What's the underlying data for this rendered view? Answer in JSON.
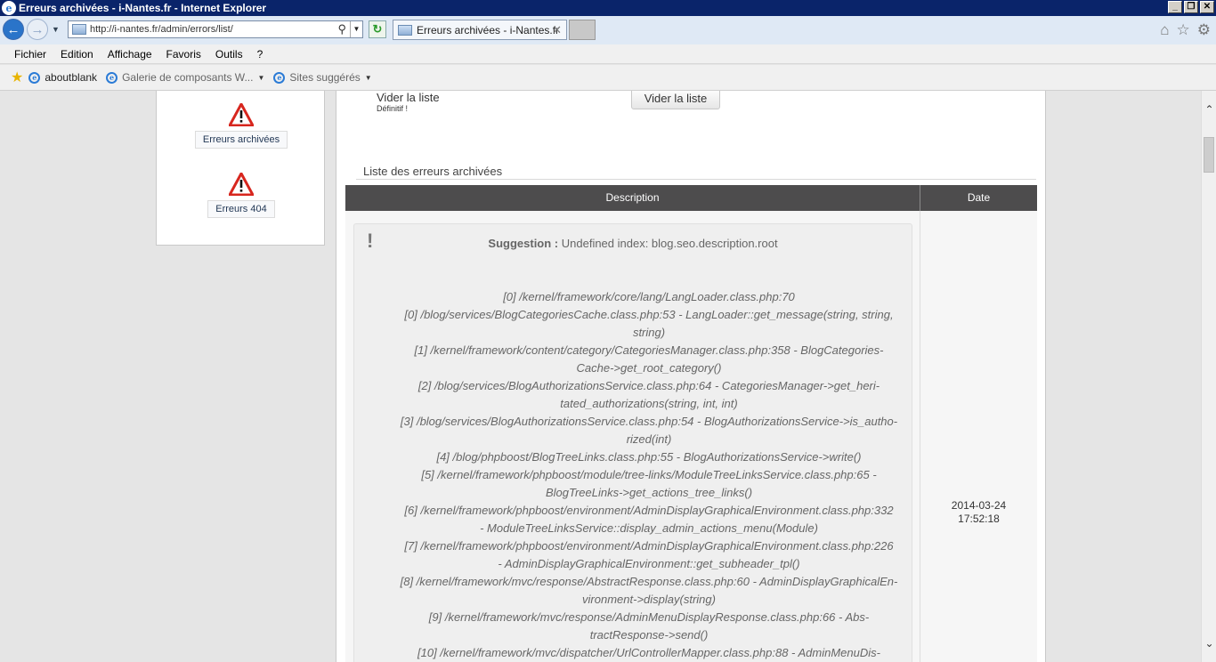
{
  "window": {
    "title": "Erreurs archivées - i-Nantes.fr - Internet Explorer",
    "minimize": "_",
    "restore": "❐",
    "close": "✕"
  },
  "nav": {
    "url": "http://i-nantes.fr/admin/errors/list/",
    "tab_label": "Erreurs archivées - i-Nantes.fr",
    "icons": [
      "back-icon",
      "forward-icon",
      "search-icon",
      "refresh-icon",
      "home-icon",
      "star-icon",
      "gear-icon"
    ]
  },
  "menu": {
    "items": [
      "Fichier",
      "Edition",
      "Affichage",
      "Favoris",
      "Outils",
      "?"
    ]
  },
  "favorites": {
    "items": [
      {
        "label": "aboutblank"
      },
      {
        "label": "Galerie de composants W..."
      },
      {
        "label": "Sites suggérés"
      }
    ]
  },
  "sidebar": {
    "tiles": [
      {
        "label": "Erreurs archivées"
      },
      {
        "label": "Erreurs 404"
      }
    ]
  },
  "main": {
    "clear_title": "Vider la liste",
    "clear_sub": "Définitif !",
    "clear_button": "Vider la liste",
    "section_title": "Liste des erreurs archivées",
    "table": {
      "headers": [
        "Description",
        "Date"
      ],
      "row": {
        "suggestion_label": "Suggestion :",
        "suggestion_text": "Undefined index: blog.seo.description.root",
        "trace": [
          "[0] /kernel/framework/core/lang/LangLoader.class.php:70",
          "[0] /blog/services/BlogCategoriesCache.class.php:53 - LangLoader::get_message(string, string,",
          "string)",
          "[1] /kernel/framework/content/category/CategoriesManager.class.php:358 - BlogCategories-",
          "Cache->get_root_category()",
          "[2] /blog/services/BlogAuthorizationsService.class.php:64 - CategoriesManager->get_heri-",
          "tated_authorizations(string, int, int)",
          "[3] /blog/services/BlogAuthorizationsService.class.php:54 - BlogAuthorizationsService->is_autho-",
          "rized(int)",
          "[4] /blog/phpboost/BlogTreeLinks.class.php:55 - BlogAuthorizationsService->write()",
          "[5] /kernel/framework/phpboost/module/tree-links/ModuleTreeLinksService.class.php:65 -",
          "BlogTreeLinks->get_actions_tree_links()",
          "[6] /kernel/framework/phpboost/environment/AdminDisplayGraphicalEnvironment.class.php:332",
          "- ModuleTreeLinksService::display_admin_actions_menu(Module)",
          "[7] /kernel/framework/phpboost/environment/AdminDisplayGraphicalEnvironment.class.php:226",
          "- AdminDisplayGraphicalEnvironment::get_subheader_tpl()",
          "[8] /kernel/framework/mvc/response/AbstractResponse.class.php:60 - AdminDisplayGraphicalEn-",
          "vironment->display(string)",
          "[9] /kernel/framework/mvc/response/AdminMenuDisplayResponse.class.php:66 - Abs-",
          "tractResponse->send()",
          "[10] /kernel/framework/mvc/dispatcher/UrlControllerMapper.class.php:88 - AdminMenuDis-"
        ],
        "date_day": "2014-03-24",
        "date_time": "17:52:18"
      }
    }
  }
}
